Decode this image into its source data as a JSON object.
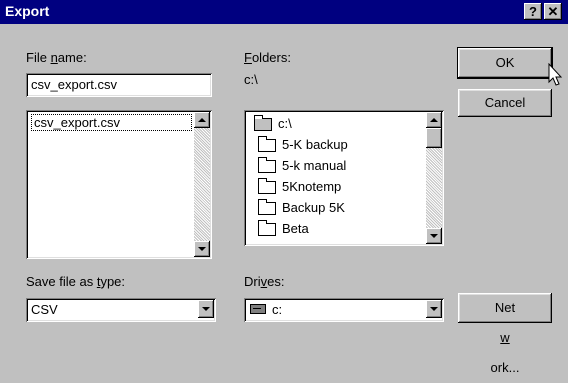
{
  "window": {
    "title": "Export"
  },
  "titlebar_buttons": {
    "help": "?",
    "close": "✕"
  },
  "file_name": {
    "label_pre": "File ",
    "label_key": "n",
    "label_post": "ame:",
    "value": "csv_export.csv",
    "list": [
      "csv_export.csv"
    ]
  },
  "folders": {
    "label_pre": "",
    "label_key": "F",
    "label_post": "olders:",
    "path": "c:\\",
    "items": [
      "c:\\",
      "5-K backup",
      "5-k manual",
      "5Knotemp",
      "Backup 5K",
      "Beta"
    ]
  },
  "save_type": {
    "label_pre": "Save file as ",
    "label_key": "t",
    "label_post": "ype:",
    "value": "CSV"
  },
  "drives": {
    "label_pre": "Dri",
    "label_key": "v",
    "label_post": "es:",
    "value": "c:"
  },
  "buttons": {
    "ok": "OK",
    "cancel": "Cancel",
    "network_pre": "Net",
    "network_key": "w",
    "network_post": "ork..."
  },
  "icons": {
    "folder": "folder-icon",
    "open_folder": "open-folder-icon",
    "drive": "hard-drive-icon",
    "dropdown": "chevron-down-icon",
    "cursor": "mouse-pointer-icon"
  }
}
